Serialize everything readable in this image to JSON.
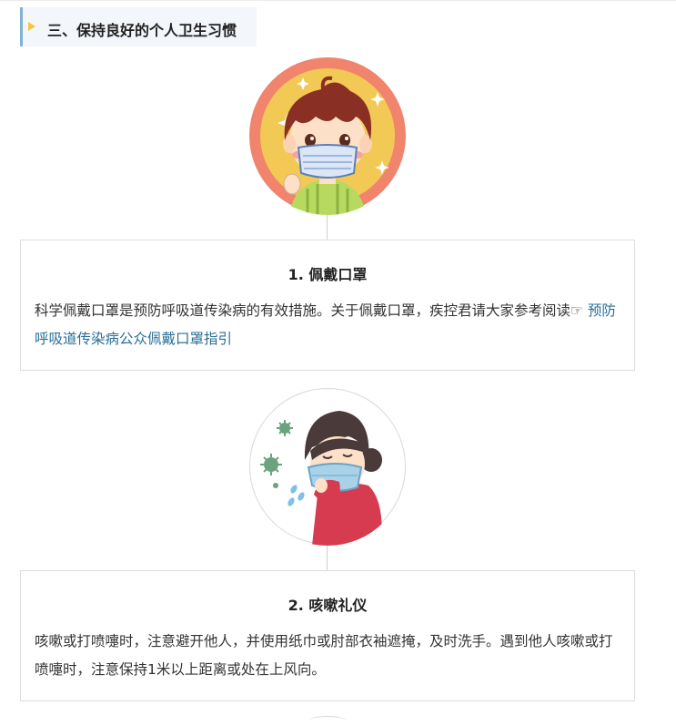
{
  "section": {
    "title": "三、保持良好的个人卫生习惯"
  },
  "cards": [
    {
      "title": "1. 佩戴口罩",
      "body_text": "科学佩戴口罩是预防呼吸道传染病的有效措施。关于佩戴口罩，疾控君请大家参考阅读",
      "pointer_glyph": "☞",
      "link_text": " 预防呼吸道传染病公众佩戴口罩指引"
    },
    {
      "title": "2. 咳嗽礼仪",
      "body_text": "咳嗽或打喷嚏时，注意避开他人，并使用纸巾或肘部衣袖遮掩，及时洗手。遇到他人咳嗽或打喷嚏时，注意保持1米以上距离或处在上风向。"
    }
  ],
  "colors": {
    "header_bg": "#f3f6fa",
    "header_bar": "#7fb3d8",
    "header_arrow": "#f5c542",
    "link": "#2a6f97",
    "card_border": "#dddddd"
  },
  "icons": {
    "header_marker": "triangle-right-icon",
    "card1_image": "boy-wearing-mask-illustration",
    "card2_image": "girl-coughing-into-elbow-illustration"
  }
}
